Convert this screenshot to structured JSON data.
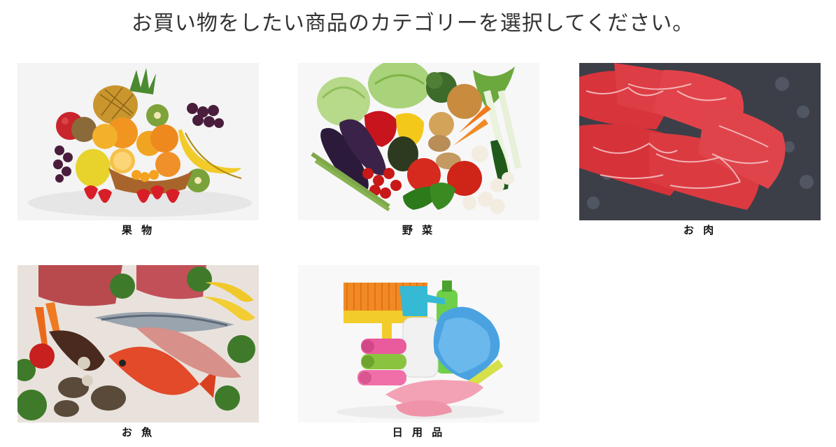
{
  "page": {
    "title": "お買い物をしたい商品のカテゴリーを選択してください。"
  },
  "categories": [
    {
      "label": "果 物",
      "image": "fruit-photo"
    },
    {
      "label": "野 菜",
      "image": "vegetable-photo"
    },
    {
      "label": "お 肉",
      "image": "meat-photo"
    },
    {
      "label": "お 魚",
      "image": "fish-photo"
    },
    {
      "label": "日 用 品",
      "image": "daily-goods-photo"
    }
  ],
  "colors": {
    "title_text": "#333333",
    "label_text": "#111111",
    "background": "#ffffff"
  }
}
